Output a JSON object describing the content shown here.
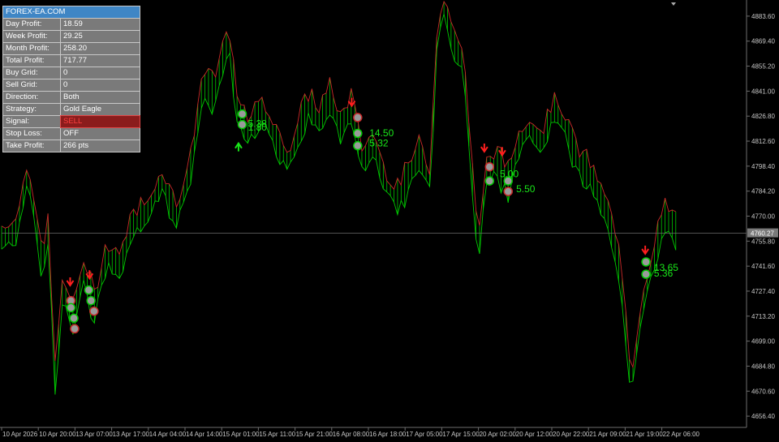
{
  "panel": {
    "header": "FOREX-EA.COM",
    "rows": [
      {
        "label": "Day Profit:",
        "value": "18.59"
      },
      {
        "label": "Week Profit:",
        "value": "29.25"
      },
      {
        "label": "Month Profit:",
        "value": "258.20"
      },
      {
        "label": "Total Profit:",
        "value": "717.77"
      },
      {
        "label": "Buy Grid:",
        "value": "0"
      },
      {
        "label": "Sell Grid:",
        "value": "0"
      },
      {
        "label": "Direction:",
        "value": "Both"
      },
      {
        "label": "Strategy:",
        "value": "Gold Eagle"
      },
      {
        "label": "Signal:",
        "value": "SELL"
      },
      {
        "label": "Stop Loss:",
        "value": "OFF"
      },
      {
        "label": "Take Profit:",
        "value": "266 pts"
      }
    ]
  },
  "chart": {
    "current_price": "4760.27",
    "price_ticks": [
      "4883.60",
      "4869.40",
      "4855.20",
      "4841.00",
      "4826.80",
      "4812.60",
      "4798.40",
      "4784.20",
      "4770.00",
      "4755.80",
      "4741.60",
      "4727.40",
      "4713.20",
      "4699.00",
      "4684.80",
      "4670.60",
      "4656.40"
    ],
    "time_ticks": [
      "10 Apr 2026",
      "10 Apr 20:00",
      "13 Apr 07:00",
      "13 Apr 17:00",
      "14 Apr 04:00",
      "14 Apr 14:00",
      "15 Apr 01:00",
      "15 Apr 11:00",
      "15 Apr 21:00",
      "16 Apr 08:00",
      "16 Apr 18:00",
      "17 Apr 05:00",
      "17 Apr 15:00",
      "20 Apr 02:00",
      "20 Apr 12:00",
      "20 Apr 22:00",
      "21 Apr 09:00",
      "21 Apr 19:00",
      "22 Apr 06:00"
    ],
    "trade_labels": [
      {
        "text": "5.38",
        "price": 4822.6,
        "bar": 0.322
      },
      {
        "text": "1.80",
        "price": 4820.5,
        "bar": 0.322
      },
      {
        "text": "14.50",
        "price": 4817.3,
        "bar": 0.485
      },
      {
        "text": "5.32",
        "price": 4811.5,
        "bar": 0.485
      },
      {
        "text": "5.00",
        "price": 4794.0,
        "bar": 0.66
      },
      {
        "text": "5.50",
        "price": 4785.5,
        "bar": 0.682
      },
      {
        "text": "13.65",
        "price": 4740.7,
        "bar": 0.867
      },
      {
        "text": "5.36",
        "price": 4737.5,
        "bar": 0.867
      }
    ]
  },
  "colors": {
    "background": "#000000",
    "up_line": "#00c800",
    "down_line": "#c82828",
    "sell_arrow": "#ff1e1e",
    "buy_arrow": "#19e619",
    "label": "#19e619",
    "grid_line": "#6e6e6e",
    "axis_text": "#c8c8c8"
  }
}
